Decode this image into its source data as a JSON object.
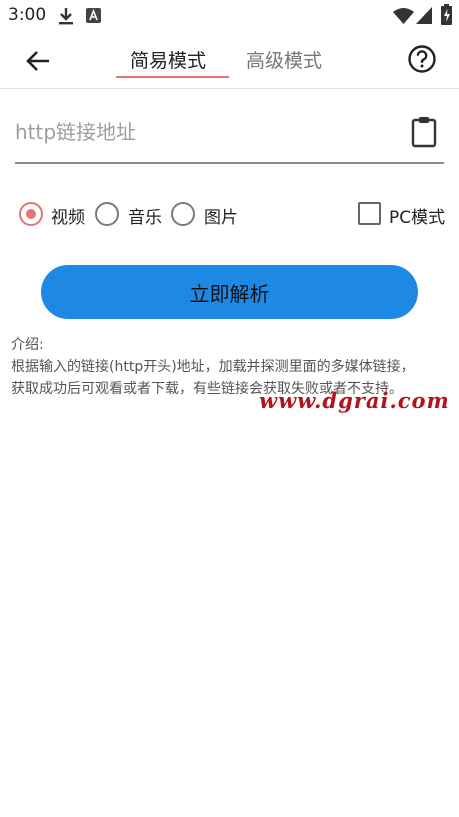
{
  "status_bar": {
    "time": "3:00",
    "icons": [
      "download-icon",
      "font-icon",
      "wifi-icon",
      "signal-icon",
      "battery-icon"
    ]
  },
  "toolbar": {
    "tabs": [
      {
        "label": "简易模式",
        "active": true
      },
      {
        "label": "高级模式",
        "active": false
      }
    ],
    "icons": [
      "arrow-left-icon",
      "help-circle-icon"
    ]
  },
  "url_field": {
    "value": "",
    "placeholder": "http链接地址",
    "paste_icon": "clipboard-icon"
  },
  "media_options": [
    {
      "label": "视频",
      "selected": true
    },
    {
      "label": "音乐",
      "selected": false
    },
    {
      "label": "图片",
      "selected": false
    }
  ],
  "pc_mode": {
    "label": "PC模式",
    "checked": false
  },
  "parse_button": {
    "label": "立即解析"
  },
  "intro": {
    "title": "介绍:",
    "lines": [
      "根据输入的链接(http开头)地址，加载并探测里面的多媒体链接，",
      "获取成功后可观看或者下载，有些链接会获取失败或者不支持。"
    ]
  },
  "watermark": "www.dgrai.com",
  "colors": {
    "accent": "#e57373",
    "primary_button": "#1e88e5",
    "watermark": "#b3141c"
  }
}
